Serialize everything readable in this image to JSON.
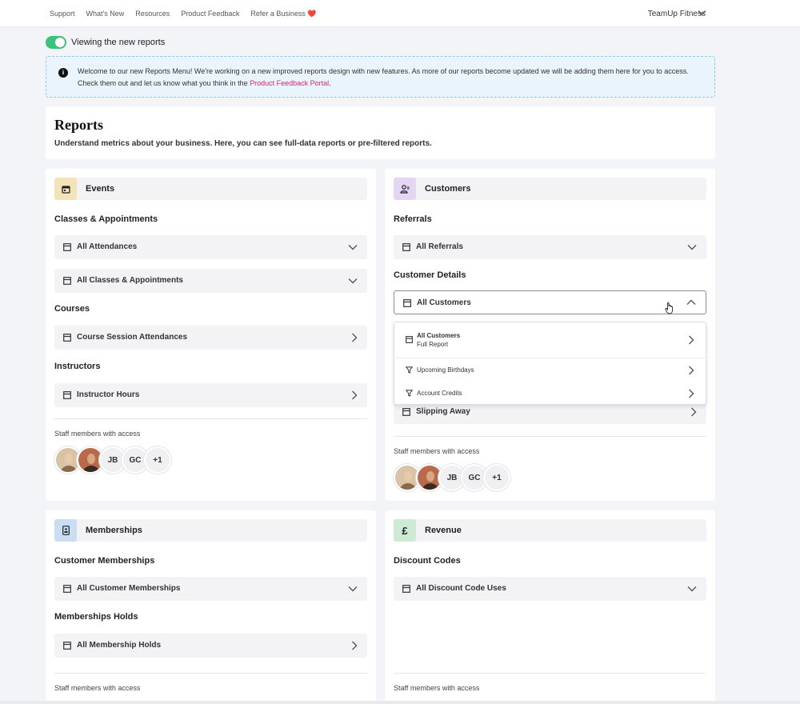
{
  "topnav": {
    "items": [
      "Support",
      "What's New",
      "Resources",
      "Product Feedback",
      "Refer a Business ❤️"
    ],
    "business_name": "TeamUp Fitness"
  },
  "toggle": {
    "label": "Viewing the new reports",
    "on": true,
    "color": "#3cc27a"
  },
  "banner": {
    "text": "Welcome to our new Reports Menu! We're working on a new improved reports design with new features. As more of our reports become updated we will be adding them here for you to access. Check them out and let us know what you think in the ",
    "link": "Product Feedback Portal",
    "after": "."
  },
  "reports": {
    "title": "Reports",
    "subtitle": "Understand metrics about your business. Here, you can see full-data reports or pre-filtered reports."
  },
  "events": {
    "title": "Events",
    "icon": "calendar-icon",
    "icon_bg": "#f3e3b8",
    "sections": {
      "classes": "Classes & Appointments",
      "courses": "Courses",
      "instructors": "Instructors"
    },
    "rows": {
      "attendances": "All Attendances",
      "classes": "All Classes & Appointments",
      "course_sessions": "Course Session Attendances",
      "instructor_hours": "Instructor Hours"
    },
    "staff_label": "Staff members with access",
    "avatars": [
      "JB",
      "GC",
      "+1"
    ]
  },
  "customers": {
    "title": "Customers",
    "icon": "users-icon",
    "icon_bg": "#e4d5f2",
    "sections": {
      "referrals": "Referrals",
      "details": "Customer Details"
    },
    "rows": {
      "referrals": "All Referrals",
      "customers": "All Customers",
      "slipping": "Slipping Away"
    },
    "dropdown": {
      "full_title": "All Customers",
      "full_sub": "Full Report",
      "birthdays": "Upcoming Birthdays",
      "credits": "Account Credits"
    },
    "staff_label": "Staff members with access",
    "avatars": [
      "JB",
      "GC",
      "+1"
    ]
  },
  "memberships": {
    "title": "Memberships",
    "icon": "id-card-icon",
    "icon_bg": "#c9def2",
    "sections": {
      "customer": "Customer Memberships",
      "holds": "Memberships Holds"
    },
    "rows": {
      "customer": "All Customer Memberships",
      "holds": "All Membership Holds"
    },
    "staff_label": "Staff members with access"
  },
  "revenue": {
    "title": "Revenue",
    "icon": "pound-icon",
    "icon_symbol": "£",
    "icon_bg": "#cdebd4",
    "sections": {
      "discounts": "Discount Codes"
    },
    "rows": {
      "discounts": "All Discount Code Uses"
    },
    "staff_label": "Staff members with access"
  }
}
